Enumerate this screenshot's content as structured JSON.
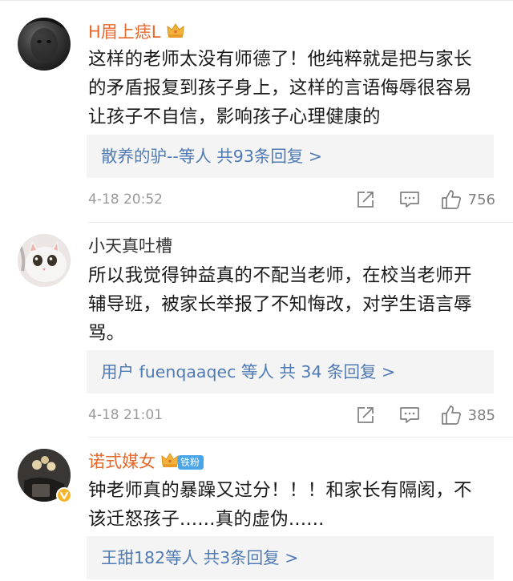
{
  "comments": [
    {
      "username": "H眉上痣L",
      "body": [
        "这样的老师太没有师德了！他纯粹就是把与家长",
        "的矛盾报复到孩子身上，这样的言语侮辱很容易",
        "让孩子不自信，影响孩子心理健康的"
      ],
      "replies": "散养的驴--等人  共93条回复 >",
      "time": "4-18 20:52",
      "likes": "756"
    },
    {
      "username": "小天真吐槽",
      "body": [
        "所以我觉得钟益真的不配当老师，在校当老师开",
        "辅导班，被家长举报了不知悔改，对学生语言辱",
        "骂。"
      ],
      "replies": "用户 fuenqaaqec 等人  共 34 条回复 >",
      "time": "4-18 21:01",
      "likes": "385"
    },
    {
      "username": "诺式媒女",
      "badge": "铁粉",
      "body": [
        "钟老师真的暴躁又过分！！！和家长有隔阂，不",
        "该迁怒孩子......真的虚伪......"
      ],
      "replies": "王甜182等人  共3条回复 >"
    }
  ],
  "icons": [
    "crown-icon",
    "share-icon",
    "comment-icon",
    "like-icon",
    "verified-icon"
  ],
  "colors": {
    "username_vip": "#e5682c",
    "reply_link": "#4f7ab3",
    "meta_gray": "#9a9a9a",
    "reply_bg": "#f4f4f4",
    "fan_badge": "#4aa4e8"
  }
}
